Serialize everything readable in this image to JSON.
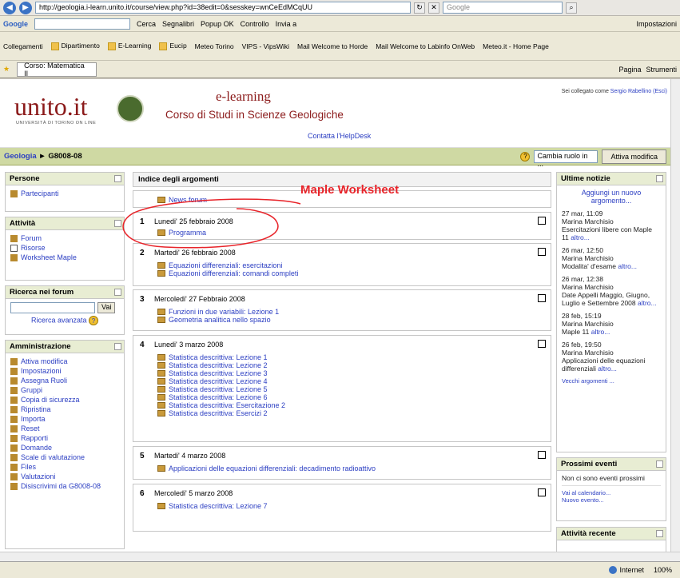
{
  "browser": {
    "address": "http://geologia.i-learn.unito.it/course/view.php?id=38edit=0&sesskey=wnCeEdMCqUU",
    "search_placeholder": "Google",
    "google_bar": [
      "Cerca",
      "Segnalibri",
      "Popup OK",
      "Controllo",
      "Invia a",
      "Impostazioni"
    ],
    "links": [
      "Collegamenti",
      "Dipartimento",
      "E-Learning",
      "Eucip",
      "Meteo Torino",
      "VIPS - VipsWiki",
      "Mail Welcome to Horde",
      "Mail Welcome to Labinfo OnWeb",
      "Meteo.it - Home Page"
    ],
    "tab_title": "Corso: Matematica II",
    "tab_tools": [
      "Pagina",
      "Strumenti"
    ],
    "status": {
      "zone": "Internet",
      "zoom": "100%"
    }
  },
  "header": {
    "logo": "unito.it",
    "logo_sub": "UNIVERSITÀ DI TORINO ON LINE",
    "elearning": "e-learning",
    "corso": "Corso di Studi in Scienze Geologiche",
    "logged_prefix": "Sei collegato come ",
    "logged_user": "Sergio Rabellino",
    "logged_exit": "(Esci)",
    "helpdesk": "Contatta l'HelpDesk"
  },
  "breadcrumb": {
    "root": "Geologia",
    "course": "G8008-08"
  },
  "role_select": "Cambia ruolo in ...",
  "edit_button": "Attiva modifica",
  "left": {
    "persone": {
      "title": "Persone",
      "items": [
        "Partecipanti"
      ]
    },
    "attivita": {
      "title": "Attività",
      "items": [
        "Forum",
        "Risorse",
        "Worksheet Maple"
      ]
    },
    "ricerca": {
      "title": "Ricerca nei forum",
      "button": "Vai",
      "advanced": "Ricerca avanzata"
    },
    "amministrazione": {
      "title": "Amministrazione",
      "items": [
        "Attiva modifica",
        "Impostazioni",
        "Assegna Ruoli",
        "Gruppi",
        "Copia di sicurezza",
        "Ripristina",
        "Importa",
        "Reset",
        "Rapporti",
        "Domande",
        "Scale di valutazione",
        "Files",
        "Valutazioni",
        "Disiscrivimi da G8008-08"
      ]
    }
  },
  "center": {
    "title": "Indice degli argomenti",
    "news": "News forum",
    "topics": [
      {
        "num": "1",
        "date": "Lunedi' 25 febbraio 2008",
        "items": [
          "Programma"
        ]
      },
      {
        "num": "2",
        "date": "Martedi' 26 febbraio 2008",
        "items": [
          "Equazioni differenziali: esercitazioni",
          "Equazioni differenziali: comandi completi"
        ]
      },
      {
        "num": "3",
        "date": "Mercoledi' 27 Febbraio 2008",
        "items": [
          "Funzioni in due variabili: Lezione 1",
          "Geometria analitica nello spazio"
        ]
      },
      {
        "num": "4",
        "date": "Lunedi' 3 marzo 2008",
        "items": [
          "Statistica descrittiva: Lezione 1",
          "Statistica descrittiva: Lezione 2",
          "Statistica descrittiva: Lezione 3",
          "Statistica descrittiva: Lezione 4",
          "Statistica descrittiva: Lezione 5",
          "Statistica descrittiva: Lezione 6",
          "Statistica descrittiva: Esercitazione 2",
          "Statistica descrittiva: Esercizi 2"
        ]
      },
      {
        "num": "5",
        "date": "Martedi' 4 marzo 2008",
        "items": [
          "Applicazioni delle equazioni differenziali: decadimento radioattivo"
        ]
      },
      {
        "num": "6",
        "date": "Mercoledi' 5 marzo 2008",
        "items": [
          "Statistica descrittiva: Lezione 7"
        ]
      }
    ]
  },
  "annotation": "Maple Worksheet",
  "right": {
    "news": {
      "title": "Ultime notizie",
      "add": "Aggiungi un nuovo argomento...",
      "items": [
        {
          "when": "27 mar, 11:09",
          "who": "Marina Marchisio",
          "text": "Esercitazioni libere con Maple 11",
          "more": "altro..."
        },
        {
          "when": "26 mar, 12:50",
          "who": "Marina Marchisio",
          "text": "Modalita' d'esame",
          "more": "altro..."
        },
        {
          "when": "26 mar, 12:38",
          "who": "Marina Marchisio",
          "text": "Date Appelli Maggio, Giugno, Luglio e Settembre 2008",
          "more": "altro..."
        },
        {
          "when": "28 feb, 15:19",
          "who": "Marina Marchisio",
          "text": "Maple 11",
          "more": "altro..."
        },
        {
          "when": "26 feb, 19:50",
          "who": "Marina Marchisio",
          "text": "Applicazioni delle equazioni differenziali",
          "more": "altro..."
        }
      ],
      "older": "Vecchi argomenti ..."
    },
    "eventi": {
      "title": "Prossimi eventi",
      "none": "Non ci sono eventi prossimi",
      "calendar": "Vai al calendario...",
      "new": "Nuovo evento..."
    },
    "recente": {
      "title": "Attività recente"
    }
  }
}
